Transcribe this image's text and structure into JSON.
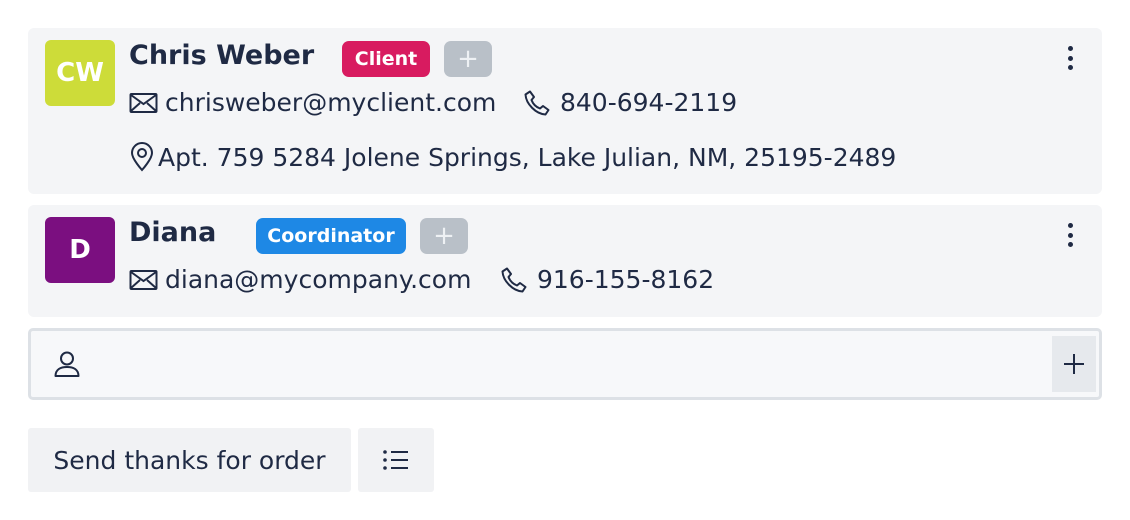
{
  "contacts": [
    {
      "initials": "CW",
      "avatar_color": "#cddc39",
      "name": "Chris Weber",
      "role": "Client",
      "role_color": "#d81b60",
      "add_tag_label": "+",
      "email": "chrisweber@myclient.com",
      "phone": "840-694-2119",
      "address": "Apt. 759 5284 Jolene Springs, Lake Julian, NM, 25195-2489"
    },
    {
      "initials": "D",
      "avatar_color": "#7b0f80",
      "name": "Diana",
      "role": "Coordinator",
      "role_color": "#1e88e5",
      "add_tag_label": "+",
      "email": "diana@mycompany.com",
      "phone": "916-155-8162"
    }
  ],
  "contact_input": {
    "placeholder": "",
    "icon": "person-icon",
    "add_icon": "plus-icon"
  },
  "actions": {
    "send_label": "Send thanks for order",
    "list_icon": "list-icon"
  }
}
